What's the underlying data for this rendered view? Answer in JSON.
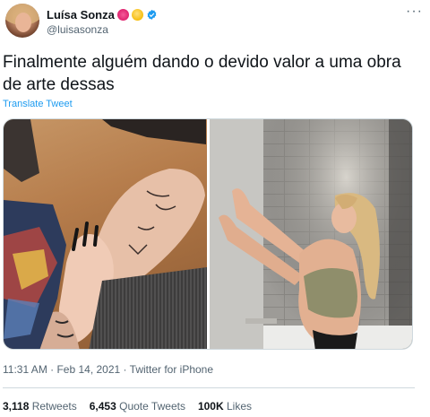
{
  "author": {
    "display_name": "Luísa Sonza",
    "handle": "@luisasonza",
    "emojis": [
      "heart-face-emoji",
      "relieved-face-emoji"
    ],
    "verified": true
  },
  "tweet": {
    "text": "Finalmente alguém dando o devido valor a uma obra de arte dessas",
    "translate_label": "Translate Tweet",
    "timestamp": "11:31 AM · Feb 14, 2021 · Twitter for iPhone"
  },
  "media": {
    "count": 2
  },
  "stats": {
    "retweets_count": "3,118",
    "retweets_label": "Retweets",
    "quotes_count": "6,453",
    "quotes_label": "Quote Tweets",
    "likes_count": "100K",
    "likes_label": "Likes"
  },
  "colors": {
    "link": "#1d9bf0",
    "verified": "#1d9bf0",
    "secondary_text": "#536471",
    "primary_text": "#0f1419",
    "border": "#cfd9de"
  }
}
